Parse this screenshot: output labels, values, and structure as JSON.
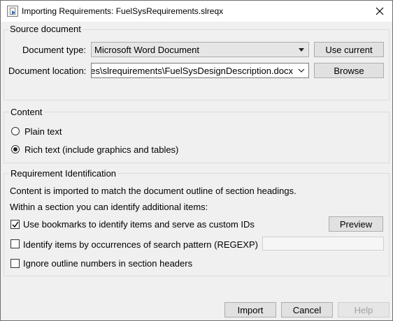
{
  "window": {
    "title": "Importing Requirements: FuelSysRequirements.slreqx",
    "close_icon": "close-icon"
  },
  "source": {
    "group_title": "Source document",
    "doc_type_label": "Document type:",
    "doc_type_value": "Microsoft Word Document",
    "use_current_label": "Use current",
    "doc_location_label": "Document location:",
    "doc_location_value": "les\\slrequirements\\FuelSysDesignDescription.docx",
    "browse_label": "Browse"
  },
  "content": {
    "group_title": "Content",
    "options": [
      {
        "label": "Plain text",
        "selected": false
      },
      {
        "label": "Rich text (include graphics and tables)",
        "selected": true
      }
    ]
  },
  "identification": {
    "group_title": "Requirement Identification",
    "line1": "Content is imported to match the document outline of section headings.",
    "line2": "Within a section you can identify additional items:",
    "bookmarks_label": "Use bookmarks to identify items and serve as custom IDs",
    "bookmarks_checked": true,
    "preview_label": "Preview",
    "regexp_label": "Identify items by occurrences of search pattern (REGEXP)",
    "regexp_checked": false,
    "regexp_value": "",
    "ignore_label": "Ignore outline numbers in section headers",
    "ignore_checked": false
  },
  "footer": {
    "import_label": "Import",
    "cancel_label": "Cancel",
    "help_label": "Help"
  }
}
